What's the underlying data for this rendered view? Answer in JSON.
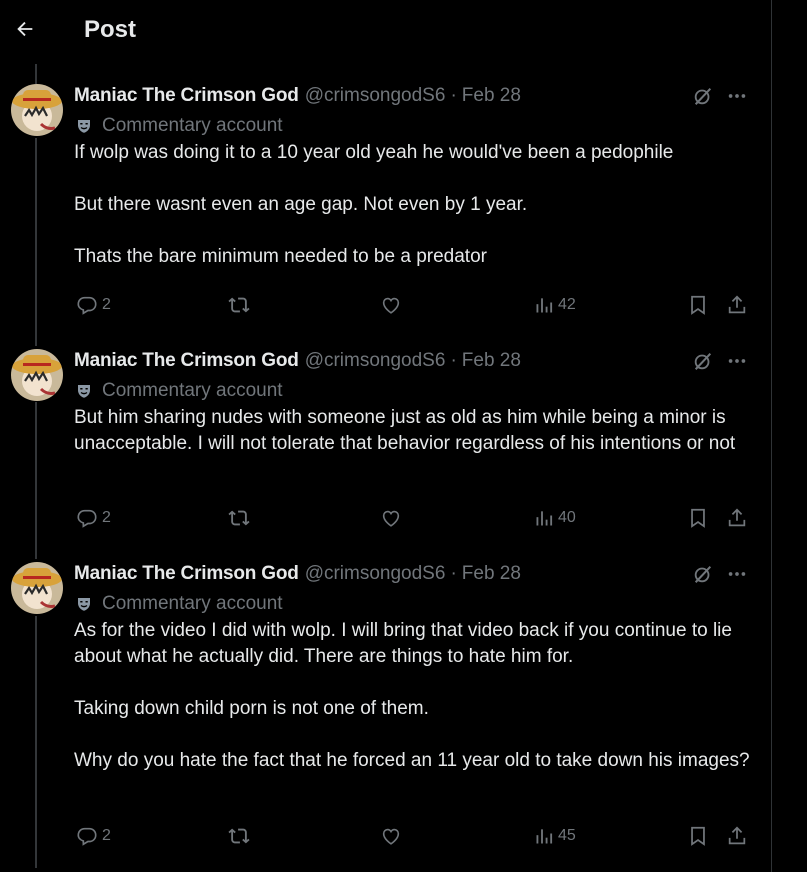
{
  "header": {
    "title": "Post"
  },
  "posts": [
    {
      "author": {
        "name": "Maniac The Crimson God",
        "handle": "@crimsongodS6",
        "date": "Feb 28",
        "label": "Commentary account"
      },
      "paragraphs": [
        "If wolp was doing it to a 10 year old yeah he would've been a pedophile",
        "But there wasnt even an age gap. Not even by 1 year.",
        "Thats the bare minimum needed to be a predator"
      ],
      "stats": {
        "replies": "2",
        "views": "42"
      }
    },
    {
      "author": {
        "name": "Maniac The Crimson God",
        "handle": "@crimsongodS6",
        "date": "Feb 28",
        "label": "Commentary account"
      },
      "paragraphs": [
        "But him sharing nudes with someone just as old as him while being a minor is unacceptable. I will not tolerate that behavior regardless of his intentions or not"
      ],
      "stats": {
        "replies": "2",
        "views": "40"
      }
    },
    {
      "author": {
        "name": "Maniac The Crimson God",
        "handle": "@crimsongodS6",
        "date": "Feb 28",
        "label": "Commentary account"
      },
      "paragraphs": [
        "As for the video I did with wolp. I will bring that video back if you continue to lie about what he actually did. There are things to hate him for.",
        "Taking down child porn is not one of them.",
        "Why do you hate the fact that he forced an 11 year old to take down his images?"
      ],
      "stats": {
        "replies": "2",
        "views": "45"
      }
    }
  ],
  "icons": {
    "back": "arrow-left-icon",
    "grok": "grok-icon",
    "more": "more-icon",
    "label": "commentary-mask-icon",
    "reply": "reply-icon",
    "repost": "repost-icon",
    "like": "like-icon",
    "views": "views-icon",
    "bookmark": "bookmark-icon",
    "share": "share-icon"
  },
  "colors": {
    "background": "#000000",
    "text": "#e7e9ea",
    "muted": "#71767b",
    "thread_line": "#333639"
  }
}
